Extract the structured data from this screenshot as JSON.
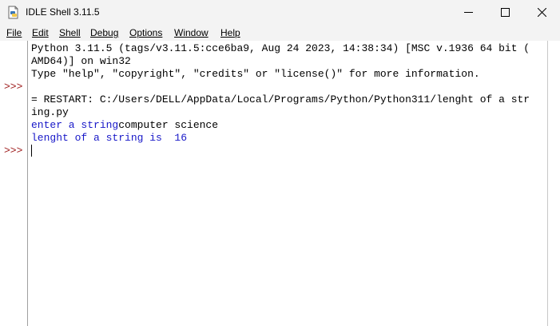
{
  "window": {
    "title": "IDLE Shell 3.11.5"
  },
  "menu": [
    "File",
    "Edit",
    "Shell",
    "Debug",
    "Options",
    "Window",
    "Help"
  ],
  "shell": {
    "prompt": ">>>",
    "lines": [
      "Python 3.11.5 (tags/v3.11.5:cce6ba9, Aug 24 2023, 14:38:34) [MSC v.1936 64 bit (",
      "AMD64)] on win32",
      "Type \"help\", \"copyright\", \"credits\" or \"license()\" for more information.",
      "= RESTART: C:/Users/DELL/AppData/Local/Programs/Python/Python311/lenght of a str",
      "ing.py",
      "enter a string",
      "computer science",
      "lenght of a string is  16"
    ]
  },
  "colors": {
    "prompt": "#a02020",
    "stdout": "#1818c8"
  }
}
